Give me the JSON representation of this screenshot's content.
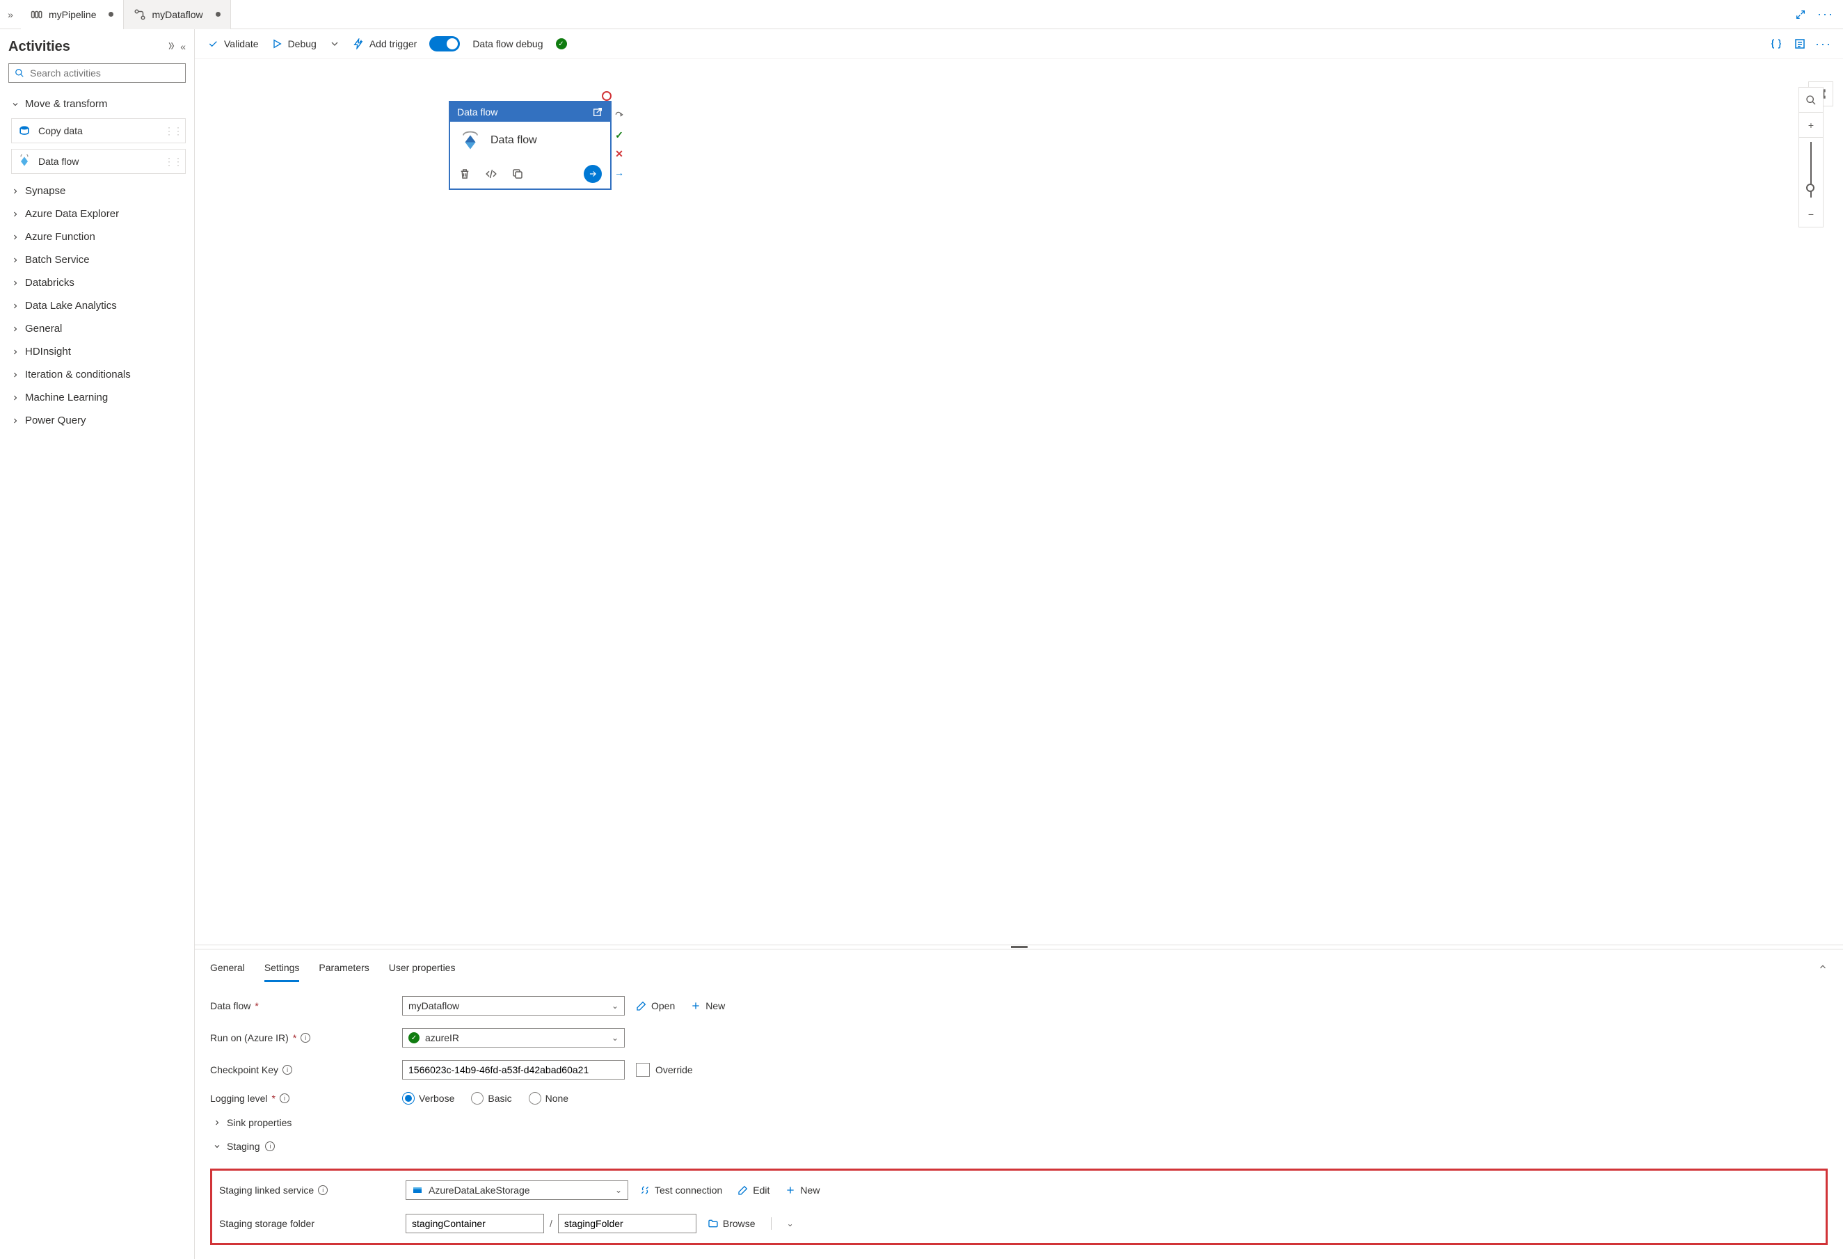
{
  "tabs": {
    "pipeline": "myPipeline",
    "dataflow": "myDataflow"
  },
  "activities": {
    "title": "Activities",
    "search_placeholder": "Search activities",
    "group_move": "Move & transform",
    "item_copy": "Copy data",
    "item_dataflow": "Data flow",
    "groups": [
      "Synapse",
      "Azure Data Explorer",
      "Azure Function",
      "Batch Service",
      "Databricks",
      "Data Lake Analytics",
      "General",
      "HDInsight",
      "Iteration & conditionals",
      "Machine Learning",
      "Power Query"
    ]
  },
  "toolbar": {
    "validate": "Validate",
    "debug": "Debug",
    "add_trigger": "Add trigger",
    "debug_label": "Data flow debug"
  },
  "node": {
    "header": "Data flow",
    "title": "Data flow"
  },
  "props_tabs": {
    "general": "General",
    "settings": "Settings",
    "parameters": "Parameters",
    "user_props": "User properties"
  },
  "form": {
    "dataflow_label": "Data flow",
    "dataflow_value": "myDataflow",
    "open": "Open",
    "new": "New",
    "runon_label": "Run on (Azure IR)",
    "runon_value": "azureIR",
    "checkpoint_label": "Checkpoint Key",
    "checkpoint_value": "1566023c-14b9-46fd-a53f-d42abad60a21",
    "override": "Override",
    "logging_label": "Logging level",
    "log_verbose": "Verbose",
    "log_basic": "Basic",
    "log_none": "None",
    "sink_props": "Sink properties",
    "staging": "Staging",
    "staging_linked_label": "Staging linked service",
    "staging_linked_value": "AzureDataLakeStorage",
    "test_conn": "Test connection",
    "edit": "Edit",
    "staging_folder_label": "Staging storage folder",
    "container_value": "stagingContainer",
    "folder_value": "stagingFolder",
    "browse": "Browse"
  }
}
